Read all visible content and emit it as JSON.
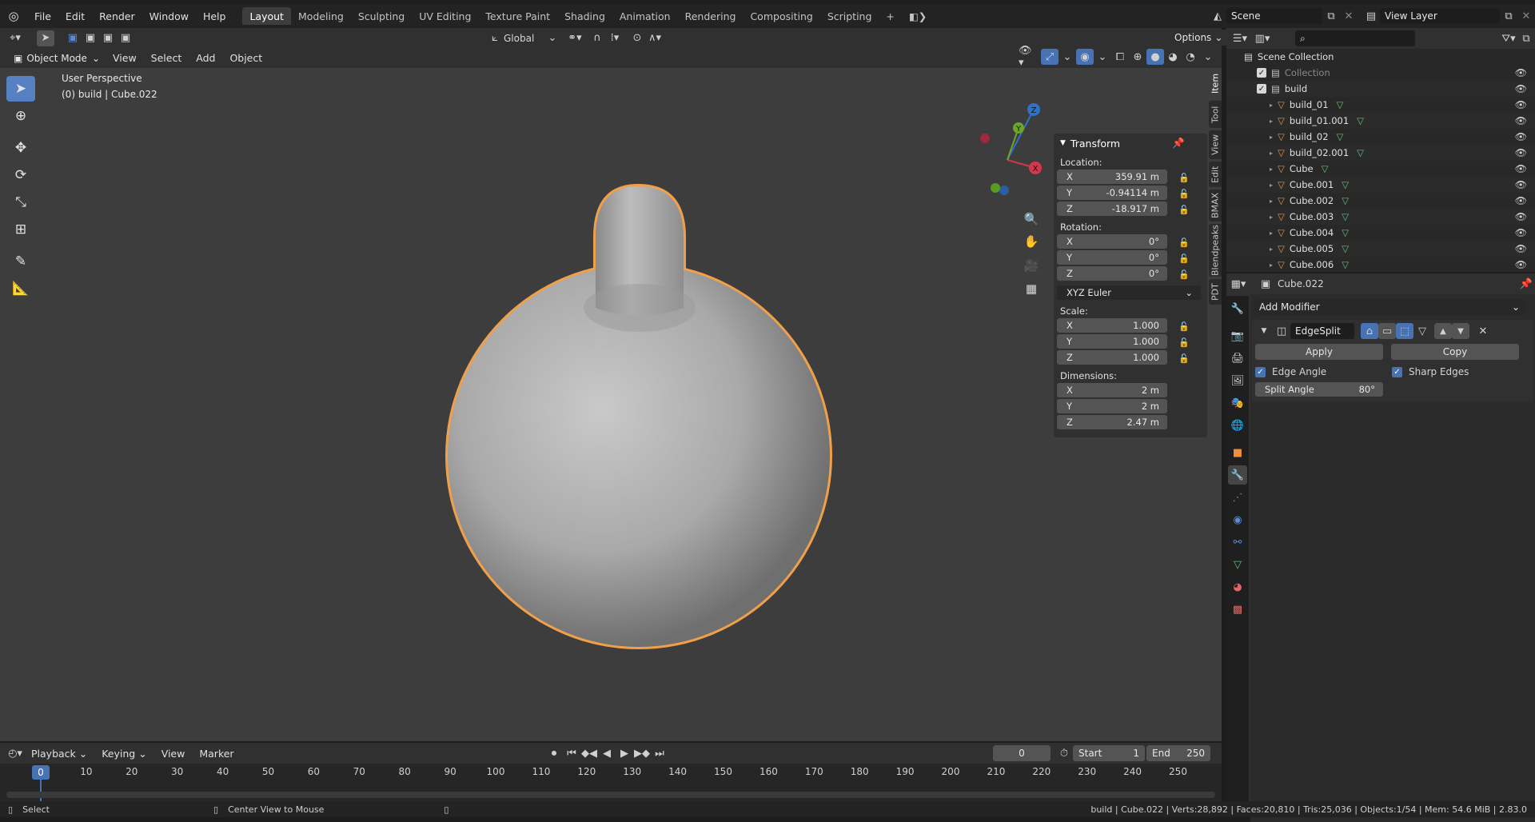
{
  "topbar": {
    "menus": [
      "File",
      "Edit",
      "Render",
      "Window",
      "Help"
    ],
    "workspaces": [
      "Layout",
      "Modeling",
      "Sculpting",
      "UV Editing",
      "Texture Paint",
      "Shading",
      "Animation",
      "Rendering",
      "Compositing",
      "Scripting"
    ],
    "active_workspace": "Layout",
    "scene": "Scene",
    "view_layer": "View Layer"
  },
  "viewport": {
    "orientation": "Global",
    "options_label": "Options",
    "mode": "Object Mode",
    "menus": [
      "View",
      "Select",
      "Add",
      "Object"
    ],
    "perspective": "User Perspective",
    "object_info": "(0) build | Cube.022",
    "gizmo": {
      "x": "X",
      "y": "Y",
      "z": "Z"
    }
  },
  "transform": {
    "title": "Transform",
    "location_label": "Location:",
    "location": {
      "x": "359.91 m",
      "y": "-0.94114 m",
      "z": "-18.917 m"
    },
    "rotation_label": "Rotation:",
    "rotation": {
      "x": "0°",
      "y": "0°",
      "z": "0°"
    },
    "rotation_mode": "XYZ Euler",
    "scale_label": "Scale:",
    "scale": {
      "x": "1.000",
      "y": "1.000",
      "z": "1.000"
    },
    "dimensions_label": "Dimensions:",
    "dimensions": {
      "x": "2 m",
      "y": "2 m",
      "z": "2.47 m"
    },
    "axis": {
      "x": "X",
      "y": "Y",
      "z": "Z"
    }
  },
  "sidebar_tabs": [
    "Item",
    "Tool",
    "View",
    "Edit",
    "BMAX",
    "Blendpeaks",
    "PDT"
  ],
  "outliner": {
    "root": "Scene Collection",
    "items": [
      {
        "name": "Collection",
        "level": 1,
        "dim": true
      },
      {
        "name": "build",
        "level": 1
      },
      {
        "name": "build_01",
        "level": 2
      },
      {
        "name": "build_01.001",
        "level": 2
      },
      {
        "name": "build_02",
        "level": 2
      },
      {
        "name": "build_02.001",
        "level": 2
      },
      {
        "name": "Cube",
        "level": 2
      },
      {
        "name": "Cube.001",
        "level": 2
      },
      {
        "name": "Cube.002",
        "level": 2
      },
      {
        "name": "Cube.003",
        "level": 2
      },
      {
        "name": "Cube.004",
        "level": 2
      },
      {
        "name": "Cube.005",
        "level": 2
      },
      {
        "name": "Cube.006",
        "level": 2
      }
    ]
  },
  "properties": {
    "object_name": "Cube.022",
    "add_modifier": "Add Modifier",
    "modifier": {
      "name": "EdgeSplit",
      "apply": "Apply",
      "copy": "Copy",
      "edge_angle": "Edge Angle",
      "sharp_edges": "Sharp Edges",
      "split_angle_label": "Split Angle",
      "split_angle_value": "80°"
    }
  },
  "timeline": {
    "menus": [
      "Playback",
      "Keying",
      "View",
      "Marker"
    ],
    "current_frame": "0",
    "start_label": "Start",
    "start": "1",
    "end_label": "End",
    "end": "250",
    "ticks": [
      "0",
      "10",
      "20",
      "30",
      "40",
      "50",
      "60",
      "70",
      "80",
      "90",
      "100",
      "110",
      "120",
      "130",
      "140",
      "150",
      "160",
      "170",
      "180",
      "190",
      "200",
      "210",
      "220",
      "230",
      "240",
      "250"
    ]
  },
  "statusbar": {
    "left": "Select",
    "middle": "Center View to Mouse",
    "right": "build | Cube.022 | Verts:28,892 | Faces:20,810 | Tris:25,036 | Objects:1/54 | Mem: 54.6 MiB | 2.83.0"
  },
  "colors": {
    "accent": "#4772b3",
    "selection_outline": "#f0a04a",
    "background": "#3d3d3d"
  }
}
